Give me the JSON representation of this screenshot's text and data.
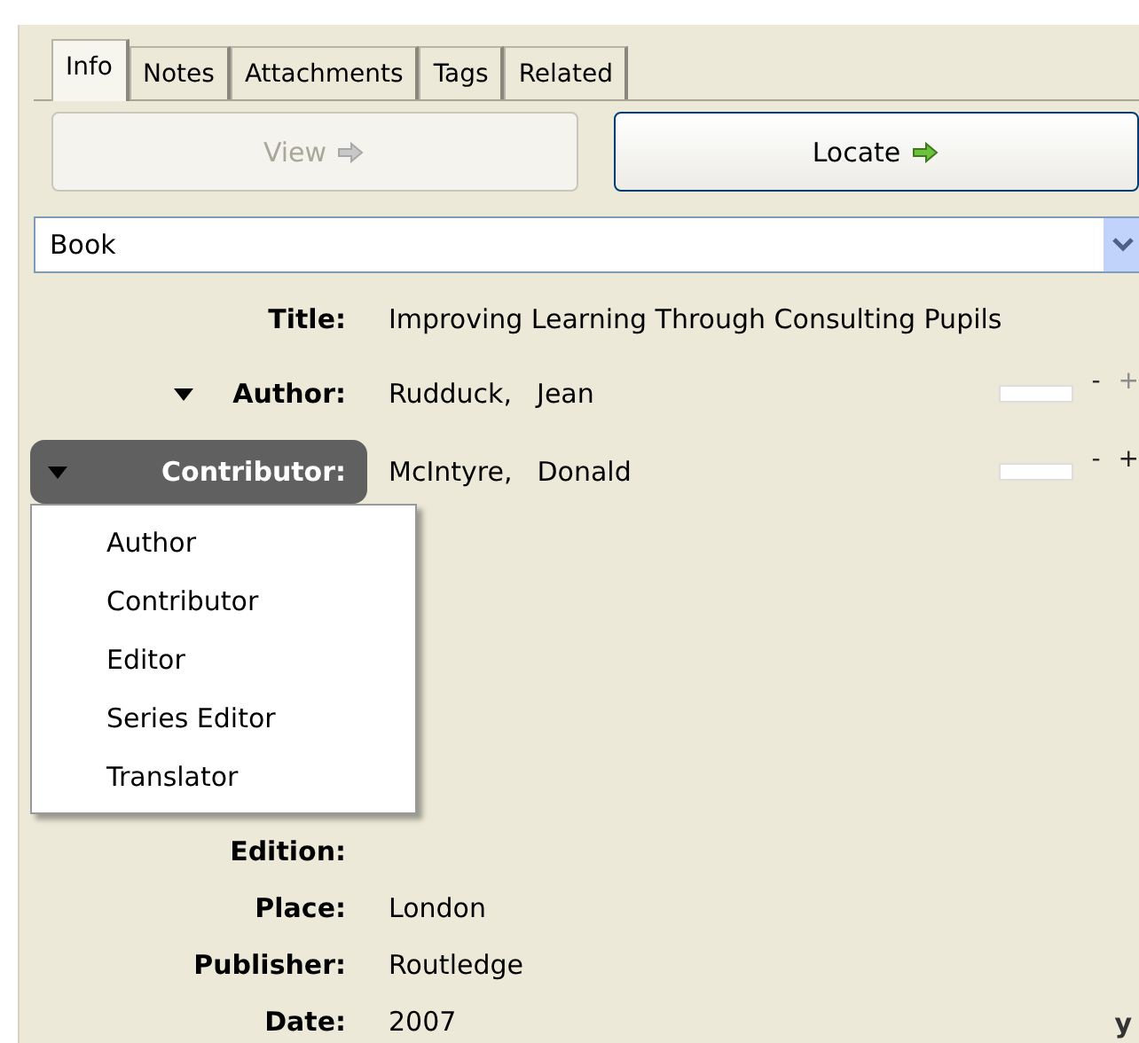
{
  "tabs": [
    {
      "label": "Info",
      "selected": true
    },
    {
      "label": "Notes",
      "selected": false
    },
    {
      "label": "Attachments",
      "selected": false
    },
    {
      "label": "Tags",
      "selected": false
    },
    {
      "label": "Related",
      "selected": false
    }
  ],
  "buttons": [
    {
      "label": "View",
      "disabled": true
    },
    {
      "label": "Locate",
      "disabled": false
    }
  ],
  "item_type": {
    "value": "Book"
  },
  "title": {
    "label": "Title:",
    "value": "Improving Learning Through Consulting Pupils"
  },
  "creators": [
    {
      "label": "Author:",
      "last": "Rudduck,",
      "first": "Jean",
      "highlighted": false,
      "minus": "-",
      "plus": "+",
      "plus_disabled": true
    },
    {
      "label": "Contributor:",
      "last": "McIntyre,",
      "first": "Donald",
      "highlighted": true,
      "minus": "-",
      "plus": "+",
      "plus_disabled": false
    }
  ],
  "creator_menu": [
    "Author",
    "Contributor",
    "Editor",
    "Series Editor",
    "Translator"
  ],
  "fields": [
    {
      "label": "Edition:"
    },
    {
      "label": "Place:",
      "value": "London"
    },
    {
      "label": "Publisher:",
      "value": "Routledge"
    },
    {
      "label": "Date:",
      "value": "2007"
    }
  ],
  "date_hint": "y"
}
